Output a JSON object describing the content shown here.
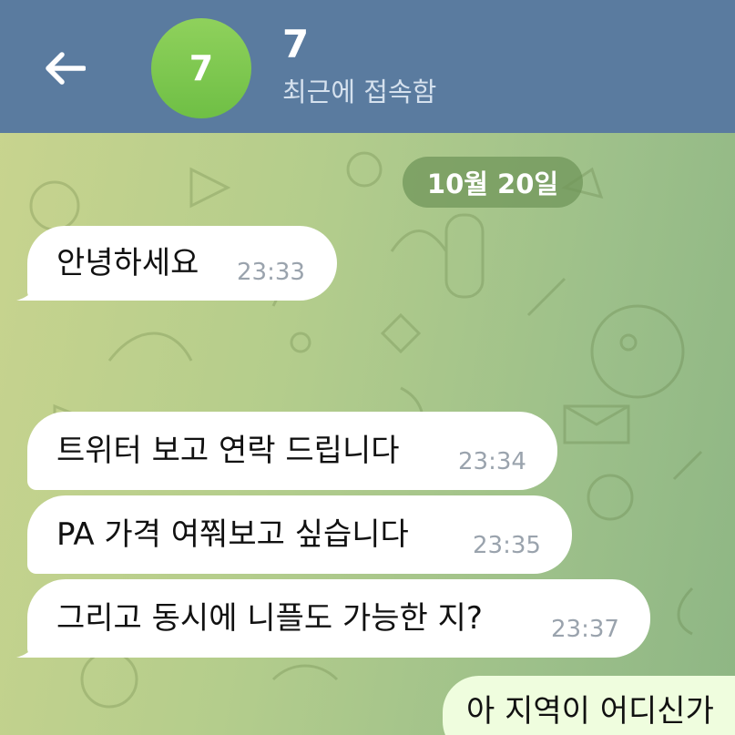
{
  "header": {
    "avatar_initial": "7",
    "contact_name": "7",
    "status": "최근에 접속함",
    "bg_color": "#5a7b9f",
    "avatar_color": "#7cc64e"
  },
  "chat": {
    "date_label": "10월 20일",
    "messages": [
      {
        "text": "안녕하세요",
        "time": "23:33",
        "direction": "incoming"
      },
      {
        "text": "트위터 보고 연락 드립니다",
        "time": "23:34",
        "direction": "incoming"
      },
      {
        "text": "PA 가격 여쭤보고 싶습니다",
        "time": "23:35",
        "direction": "incoming"
      },
      {
        "text": "그리고 동시에 니플도 가능한 지?",
        "time": "23:37",
        "direction": "incoming"
      },
      {
        "text": "아 지역이 어디신가",
        "time": "",
        "direction": "outgoing"
      }
    ]
  },
  "icons": {
    "back": "arrow-left-icon",
    "wallpaper": "doodle-pattern"
  }
}
